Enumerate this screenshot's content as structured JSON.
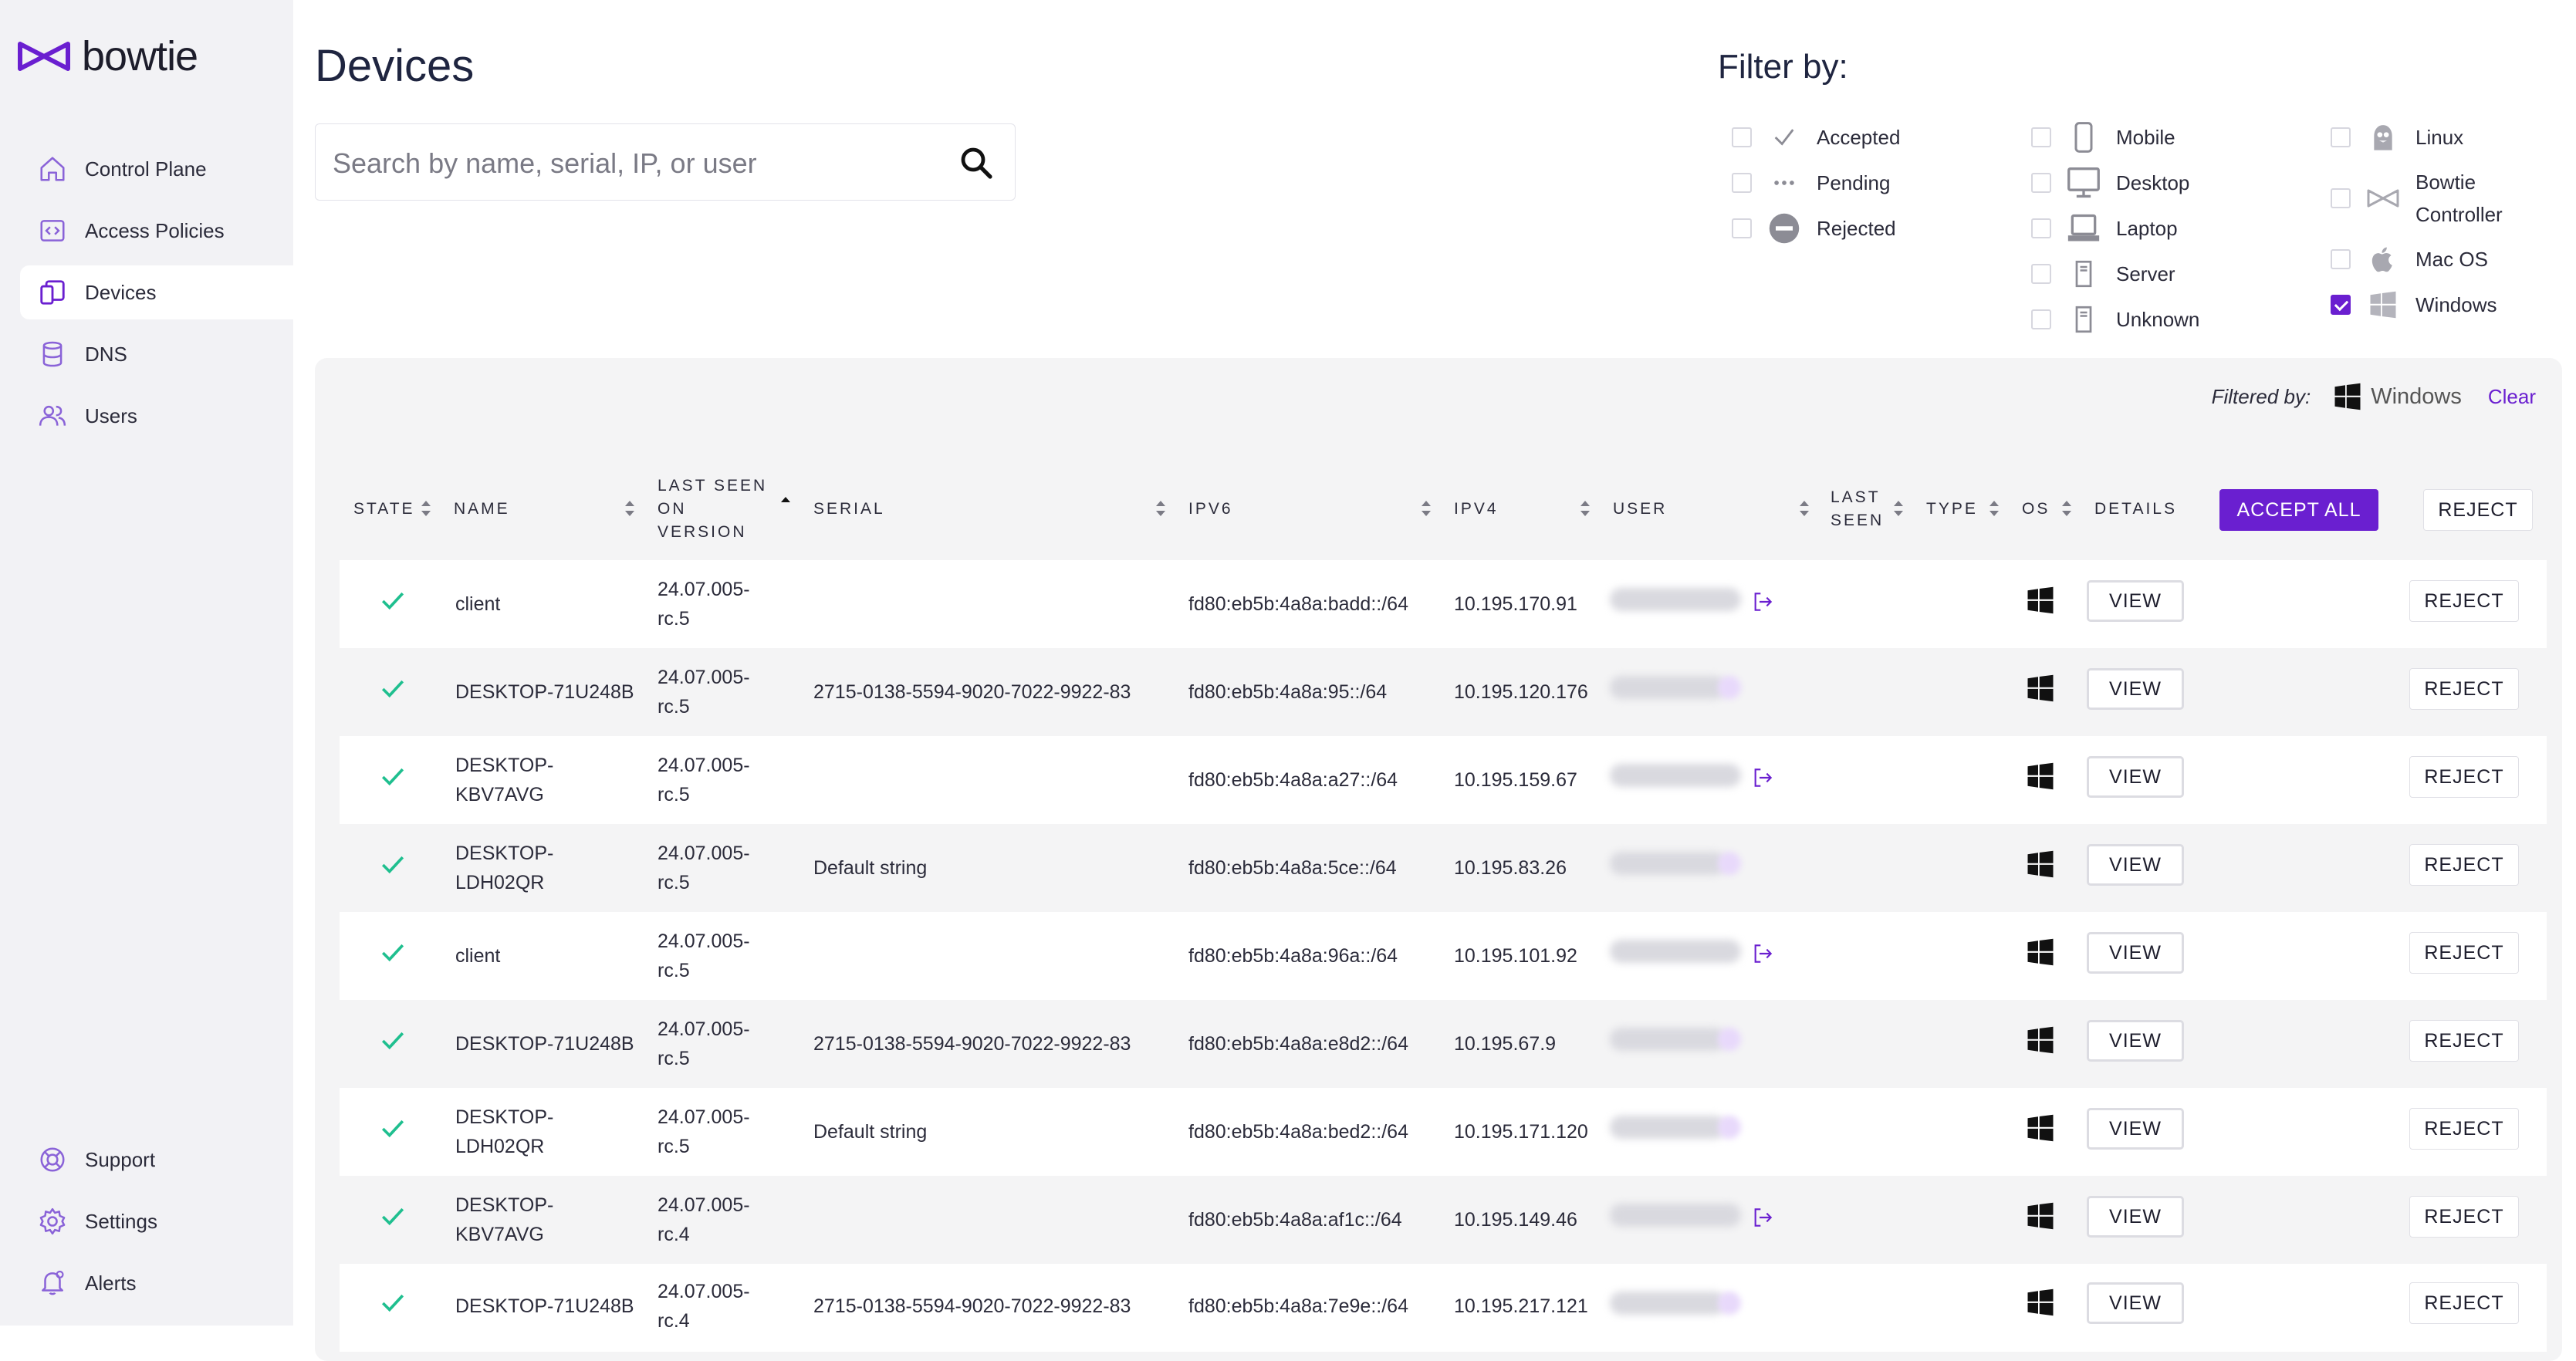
{
  "app": {
    "brand": "bowtie",
    "accent_color": "#6a1fd0"
  },
  "sidebar": {
    "items": [
      {
        "label": "Control Plane",
        "icon": "home-icon"
      },
      {
        "label": "Access Policies",
        "icon": "code-icon"
      },
      {
        "label": "Devices",
        "icon": "devices-icon",
        "active": true
      },
      {
        "label": "DNS",
        "icon": "database-icon"
      },
      {
        "label": "Users",
        "icon": "users-icon"
      }
    ],
    "bottom_items": [
      {
        "label": "Support",
        "icon": "lifebuoy-icon"
      },
      {
        "label": "Settings",
        "icon": "gear-icon"
      },
      {
        "label": "Alerts",
        "icon": "bell-icon"
      }
    ]
  },
  "page": {
    "title": "Devices",
    "search_placeholder": "Search by name, serial, IP, or user"
  },
  "filters": {
    "title": "Filter by:",
    "state": [
      {
        "label": "Accepted",
        "checked": false
      },
      {
        "label": "Pending",
        "checked": false
      },
      {
        "label": "Rejected",
        "checked": false
      }
    ],
    "type": [
      {
        "label": "Mobile",
        "checked": false
      },
      {
        "label": "Desktop",
        "checked": false
      },
      {
        "label": "Laptop",
        "checked": false
      },
      {
        "label": "Server",
        "checked": false
      },
      {
        "label": "Unknown",
        "checked": false
      }
    ],
    "os": [
      {
        "label": "Linux",
        "checked": false
      },
      {
        "label": "Bowtie Controller",
        "label_line1": "Bowtie",
        "label_line2": "Controller",
        "checked": false
      },
      {
        "label": "Mac OS",
        "checked": false
      },
      {
        "label": "Windows",
        "checked": true
      }
    ]
  },
  "filtered_by": {
    "label": "Filtered by:",
    "value": "Windows",
    "clear": "Clear"
  },
  "table": {
    "headers": {
      "state": "State",
      "name": "Name",
      "last_seen_version_1": "Last seen",
      "last_seen_version_2": "on",
      "last_seen_version_3": "version",
      "serial": "Serial",
      "ipv6": "IPv6",
      "ipv4": "IPv4",
      "user": "User",
      "last_seen_1": "Last",
      "last_seen_2": "seen",
      "type": "Type",
      "os": "OS",
      "details": "Details"
    },
    "accept_all": "ACCEPT ALL",
    "reject": "REJECT",
    "view": "VIEW",
    "rows": [
      {
        "name": "client",
        "version_1": "24.07.005-",
        "version_2": "rc.5",
        "serial": "",
        "ipv6": "fd80:eb5b:4a8a:badd::/64",
        "ipv4": "10.195.170.91",
        "user_icon": "sign-out-icon"
      },
      {
        "name": "DESKTOP-71U248B",
        "version_1": "24.07.005-",
        "version_2": "rc.5",
        "serial": "2715-0138-5594-9020-7022-9922-83",
        "ipv6": "fd80:eb5b:4a8a:95::/64",
        "ipv4": "10.195.120.176",
        "user_icon": ""
      },
      {
        "name": "DESKTOP-KBV7AVG",
        "name_1": "DESKTOP-",
        "name_2": "KBV7AVG",
        "version_1": "24.07.005-",
        "version_2": "rc.5",
        "serial": "",
        "ipv6": "fd80:eb5b:4a8a:a27::/64",
        "ipv4": "10.195.159.67",
        "user_icon": "sign-out-icon"
      },
      {
        "name": "DESKTOP-LDH02QR",
        "name_1": "DESKTOP-",
        "name_2": "LDH02QR",
        "version_1": "24.07.005-",
        "version_2": "rc.5",
        "serial": "Default string",
        "ipv6": "fd80:eb5b:4a8a:5ce::/64",
        "ipv4": "10.195.83.26",
        "user_icon": ""
      },
      {
        "name": "client",
        "version_1": "24.07.005-",
        "version_2": "rc.5",
        "serial": "",
        "ipv6": "fd80:eb5b:4a8a:96a::/64",
        "ipv4": "10.195.101.92",
        "user_icon": "sign-out-icon"
      },
      {
        "name": "DESKTOP-71U248B",
        "version_1": "24.07.005-",
        "version_2": "rc.5",
        "serial": "2715-0138-5594-9020-7022-9922-83",
        "ipv6": "fd80:eb5b:4a8a:e8d2::/64",
        "ipv4": "10.195.67.9",
        "user_icon": ""
      },
      {
        "name": "DESKTOP-LDH02QR",
        "name_1": "DESKTOP-",
        "name_2": "LDH02QR",
        "version_1": "24.07.005-",
        "version_2": "rc.5",
        "serial": "Default string",
        "ipv6": "fd80:eb5b:4a8a:bed2::/64",
        "ipv4": "10.195.171.120",
        "user_icon": ""
      },
      {
        "name": "DESKTOP-KBV7AVG",
        "name_1": "DESKTOP-",
        "name_2": "KBV7AVG",
        "version_1": "24.07.005-",
        "version_2": "rc.4",
        "serial": "",
        "ipv6": "fd80:eb5b:4a8a:af1c::/64",
        "ipv4": "10.195.149.46",
        "user_icon": "sign-out-icon"
      },
      {
        "name": "DESKTOP-71U248B",
        "version_1": "24.07.005-",
        "version_2": "rc.4",
        "serial": "2715-0138-5594-9020-7022-9922-83",
        "ipv6": "fd80:eb5b:4a8a:7e9e::/64",
        "ipv4": "10.195.217.121",
        "user_icon": ""
      }
    ]
  }
}
